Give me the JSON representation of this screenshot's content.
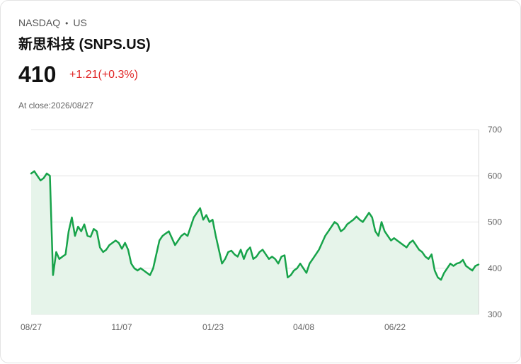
{
  "header": {
    "exchange": "NASDAQ",
    "region": "US",
    "title": "新思科技 (SNPS.US)",
    "price": "410",
    "change": "+1.21(+0.3%)",
    "close_label": "At close:2026/08/27"
  },
  "colors": {
    "line": "#17a34a",
    "fill": "#e6f4ea",
    "change": "#e02424",
    "grid": "#e4e4e4"
  },
  "chart_data": {
    "type": "area",
    "title": "",
    "xlabel": "",
    "ylabel": "",
    "ylim": [
      300,
      700
    ],
    "yticks": [
      300,
      400,
      500,
      600,
      700
    ],
    "xticks": [
      "08/27",
      "11/07",
      "01/23",
      "04/08",
      "06/22"
    ],
    "grid": true,
    "series": [
      {
        "values": [
          605,
          610,
          600,
          590,
          595,
          605,
          600,
          385,
          435,
          420,
          425,
          430,
          480,
          510,
          470,
          490,
          480,
          495,
          470,
          468,
          485,
          480,
          445,
          435,
          440,
          450,
          455,
          460,
          455,
          442,
          455,
          440,
          410,
          400,
          395,
          400,
          395,
          390,
          385,
          400,
          430,
          460,
          470,
          475,
          480,
          465,
          450,
          460,
          470,
          475,
          470,
          490,
          510,
          520,
          530,
          505,
          515,
          500,
          505,
          470,
          440,
          410,
          420,
          435,
          438,
          430,
          425,
          440,
          420,
          438,
          445,
          420,
          425,
          435,
          440,
          430,
          420,
          425,
          420,
          410,
          425,
          428,
          380,
          385,
          395,
          400,
          410,
          400,
          390,
          410,
          420,
          430,
          440,
          455,
          470,
          480,
          490,
          500,
          495,
          480,
          485,
          495,
          500,
          505,
          512,
          505,
          500,
          510,
          520,
          510,
          480,
          470,
          500,
          480,
          470,
          460,
          465,
          460,
          455,
          450,
          445,
          455,
          460,
          450,
          440,
          435,
          425,
          420,
          430,
          395,
          380,
          375,
          390,
          400,
          410,
          405,
          410,
          412,
          418,
          405,
          400,
          395,
          405,
          408
        ]
      }
    ]
  }
}
